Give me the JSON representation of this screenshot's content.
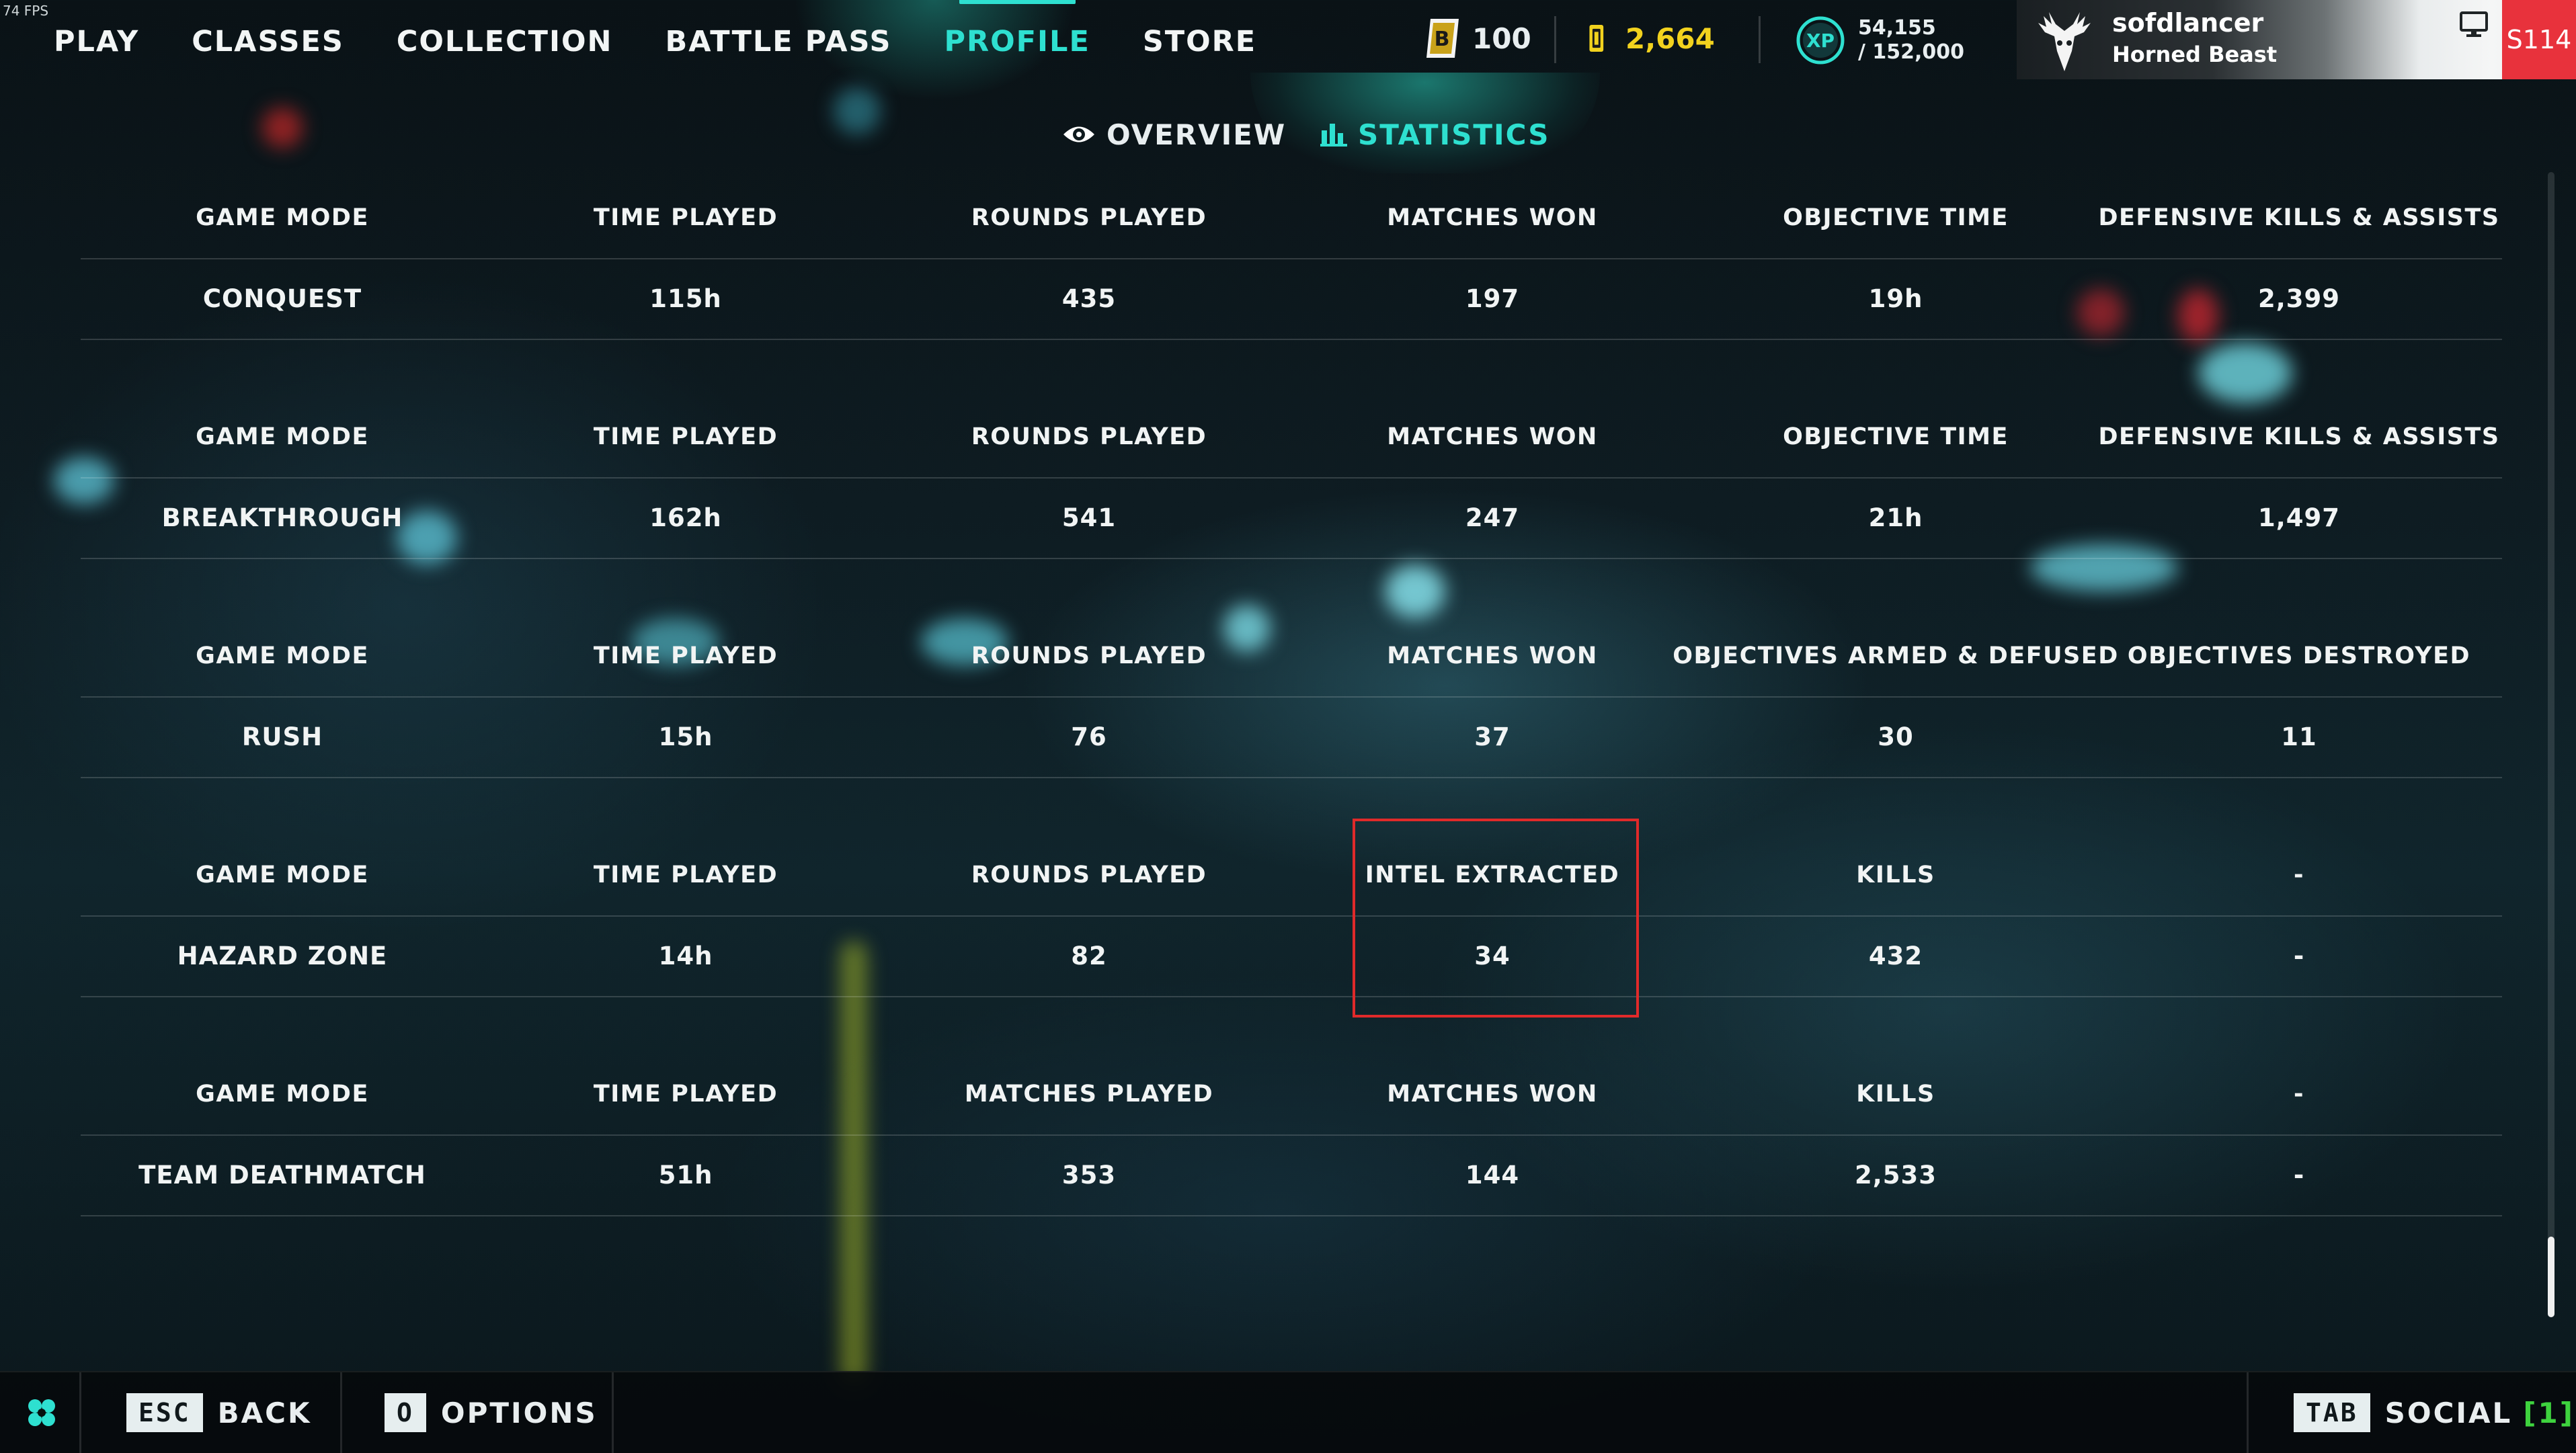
{
  "fps_counter": "74 FPS",
  "top_nav": {
    "items": [
      {
        "label": "PLAY",
        "active": false
      },
      {
        "label": "CLASSES",
        "active": false
      },
      {
        "label": "COLLECTION",
        "active": false
      },
      {
        "label": "BATTLE PASS",
        "active": false
      },
      {
        "label": "PROFILE",
        "active": true
      },
      {
        "label": "STORE",
        "active": false
      }
    ]
  },
  "currencies": {
    "battle_credits": {
      "icon": "credits-icon",
      "value": "100"
    },
    "bf_coins": {
      "icon": "coin-icon",
      "value": "2,664",
      "color": "#f2d21e"
    },
    "xp": {
      "icon": "xp-icon",
      "current": "54,155",
      "total": "/ 152,000"
    }
  },
  "profile": {
    "avatar_icon": "deer-skull-icon",
    "name": "sofdlancer",
    "title": "Horned Beast",
    "platform_icon": "pc-monitor-icon",
    "season_badge": "S114"
  },
  "subtabs": [
    {
      "label": "OVERVIEW",
      "icon": "eye-icon",
      "active": false
    },
    {
      "label": "STATISTICS",
      "icon": "bar-chart-icon",
      "active": true
    }
  ],
  "stats": [
    {
      "headers": [
        "GAME MODE",
        "TIME PLAYED",
        "ROUNDS PLAYED",
        "MATCHES WON",
        "OBJECTIVE TIME",
        "DEFENSIVE KILLS & ASSISTS"
      ],
      "values": [
        "CONQUEST",
        "115h",
        "435",
        "197",
        "19h",
        "2,399"
      ]
    },
    {
      "headers": [
        "GAME MODE",
        "TIME PLAYED",
        "ROUNDS PLAYED",
        "MATCHES WON",
        "OBJECTIVE TIME",
        "DEFENSIVE KILLS & ASSISTS"
      ],
      "values": [
        "BREAKTHROUGH",
        "162h",
        "541",
        "247",
        "21h",
        "1,497"
      ]
    },
    {
      "headers": [
        "GAME MODE",
        "TIME PLAYED",
        "ROUNDS PLAYED",
        "MATCHES WON",
        "OBJECTIVES ARMED & DEFUSED",
        "OBJECTIVES DESTROYED"
      ],
      "values": [
        "RUSH",
        "15h",
        "76",
        "37",
        "30",
        "11"
      ]
    },
    {
      "headers": [
        "GAME MODE",
        "TIME PLAYED",
        "ROUNDS PLAYED",
        "INTEL EXTRACTED",
        "KILLS",
        "-"
      ],
      "values": [
        "HAZARD ZONE",
        "14h",
        "82",
        "34",
        "432",
        "-"
      ]
    },
    {
      "headers": [
        "GAME MODE",
        "TIME PLAYED",
        "MATCHES PLAYED",
        "MATCHES WON",
        "KILLS",
        "-"
      ],
      "values": [
        "TEAM DEATHMATCH",
        "51h",
        "353",
        "144",
        "2,533",
        "-"
      ]
    }
  ],
  "bottom_bar": {
    "menu_icon": "clover-menu-icon",
    "back": {
      "key": "ESC",
      "label": "BACK"
    },
    "options": {
      "key": "O",
      "label": "OPTIONS"
    },
    "social": {
      "key": "TAB",
      "label": "SOCIAL",
      "count": "[1]"
    }
  },
  "colors": {
    "accent": "#2ee0d0",
    "gold": "#f2d21e",
    "highlight_box": "#e02a2a",
    "season_badge": "#e8323c",
    "social_count": "#3ed23e"
  }
}
